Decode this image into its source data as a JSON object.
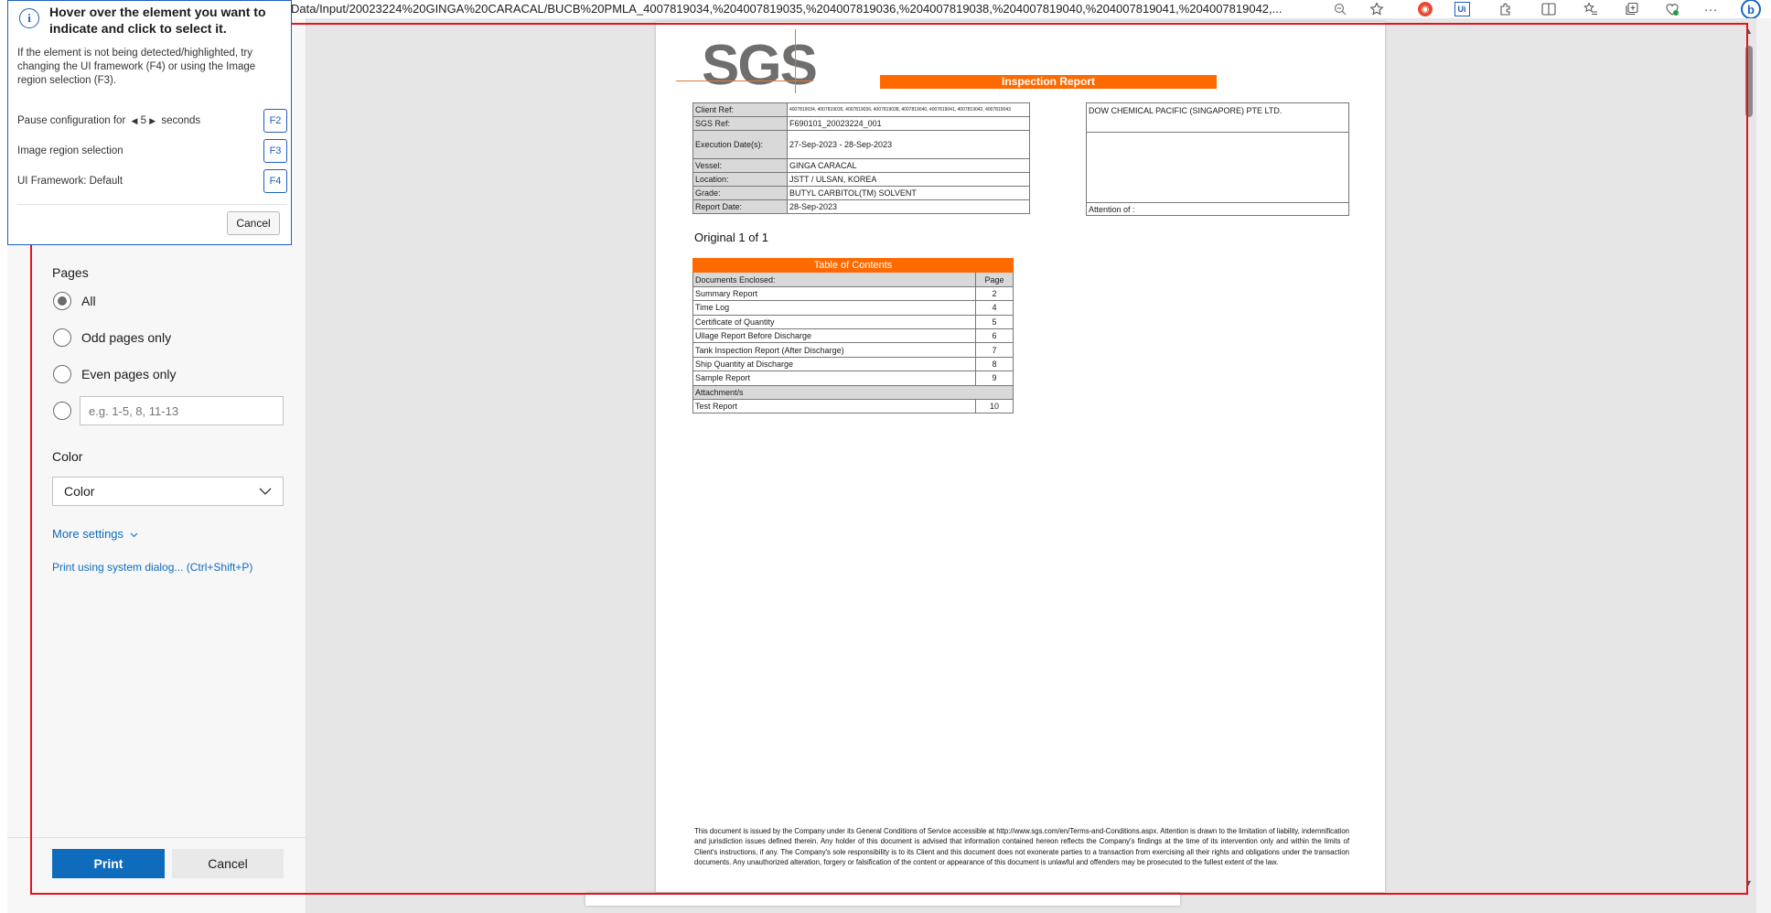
{
  "browser": {
    "address": "Data/Input/20023224%20GINGA%20CARACAL/BUCB%20PMLA_4007819034,%204007819035,%204007819036,%204007819038,%204007819040,%204007819041,%204007819042,...",
    "icons": [
      "zoom-out-icon",
      "favorite-star-icon",
      "extension-red-icon",
      "uipath-extension-icon",
      "extensions-puzzle-icon",
      "split-screen-icon",
      "favorites-icon",
      "collections-icon",
      "browser-essentials-icon",
      "more-options-icon",
      "copilot-icon"
    ],
    "ui_badge": "Ui",
    "more": "···"
  },
  "popup": {
    "info_glyph": "i",
    "title": "Hover over the element you want to indicate and click to select it.",
    "help": "If the element is not being detected/highlighted, try changing the UI framework (F4) or using the Image region selection (F3).",
    "pause_prefix": "Pause configuration for",
    "pause_value": "5",
    "pause_suffix": "seconds",
    "pause_key": "F2",
    "image_region": "Image region selection",
    "image_region_key": "F3",
    "framework": "UI Framework: Default",
    "framework_key": "F4",
    "cancel": "Cancel"
  },
  "print": {
    "pages_label": "Pages",
    "options": [
      "All",
      "Odd pages only",
      "Even pages only"
    ],
    "selected_option": "All",
    "range_placeholder": "e.g. 1-5, 8, 11-13",
    "color_label": "Color",
    "color_value": "Color",
    "more_settings": "More settings",
    "system_dialog": "Print using system dialog... (Ctrl+Shift+P)",
    "print_button": "Print",
    "cancel_button": "Cancel"
  },
  "report": {
    "logo": "SGS",
    "banner": "Inspection Report",
    "fields": [
      {
        "key": "Client Ref:",
        "value": "4007819034, 4007819035, 4007819036, 4007819038, 4007819040, 4007819041, 4007819042, 4007819043"
      },
      {
        "key": "SGS Ref:",
        "value": "F690101_20023224_001"
      },
      {
        "key": "Execution Date(s):",
        "value": "27-Sep-2023 - 28-Sep-2023"
      },
      {
        "key": "Vessel:",
        "value": "GINGA CARACAL"
      },
      {
        "key": "Location:",
        "value": "JSTT / ULSAN, KOREA"
      },
      {
        "key": "Grade:",
        "value": "BUTYL CARBITOL(TM) SOLVENT"
      },
      {
        "key": "Report Date:",
        "value": "28-Sep-2023"
      }
    ],
    "client_name": "DOW CHEMICAL PACIFIC (SINGAPORE) PTE LTD.",
    "attention": "Attention of :",
    "original": "Original 1 of 1",
    "toc_title": "Table of Contents",
    "toc_header": {
      "doc": "Documents Enclosed:",
      "page": "Page"
    },
    "toc_rows": [
      {
        "doc": "Summary Report",
        "page": "2"
      },
      {
        "doc": "Time Log",
        "page": "4"
      },
      {
        "doc": "Certificate of Quantity",
        "page": "5"
      },
      {
        "doc": "Ullage Report Before Discharge",
        "page": "6"
      },
      {
        "doc": "Tank Inspection Report (After Discharge)",
        "page": "7"
      },
      {
        "doc": "Ship Quantity at Discharge",
        "page": "8"
      },
      {
        "doc": "Sample Report",
        "page": "9"
      }
    ],
    "attachments_label": "Attachment/s",
    "attachment_rows": [
      {
        "doc": "Test Report",
        "page": "10"
      }
    ],
    "disclaimer": "This document is issued by the Company under its General Conditions of Service accessible at http://www.sgs.com/en/Terms-and-Conditions.aspx. Attention is drawn to the limitation of liability, indemnification and jurisdiction issues defined therein. Any holder of this document is advised that information contained hereon reflects the Company's findings at the time of its intervention only and within the limits of Client's instructions, if any. The Company's sole responsibility is to its Client and this document does not exonerate parties to a transaction from exercising all their rights and obligations under the transaction documents. Any unauthorized alteration, forgery or falsification of the content or appearance of this document is unlawful and offenders may be prosecuted to the fullest extent of the law."
  },
  "colors": {
    "accent": "#0f6cbd",
    "banner": "#ff6a00",
    "highlight": "#e0141e",
    "popup_border": "#1f5fbf"
  }
}
